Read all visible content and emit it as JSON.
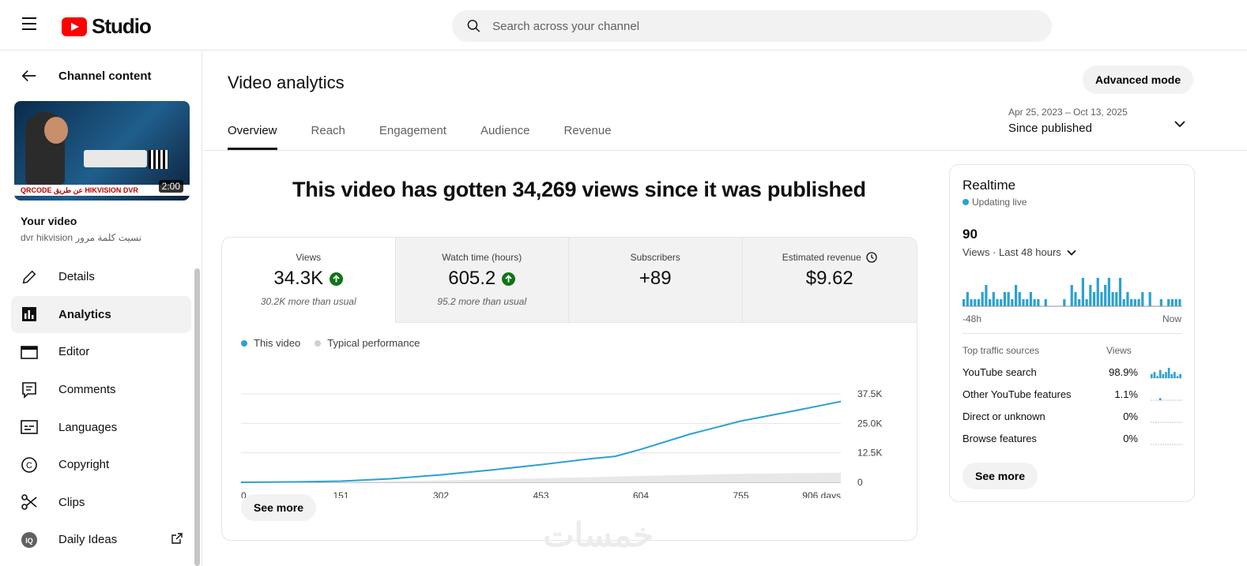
{
  "app": {
    "logo_text": "Studio",
    "search_placeholder": "Search across your channel"
  },
  "sidebar": {
    "back_label": "Channel content",
    "thumbnail": {
      "duration": "2:00",
      "banner_text": "QRCODE عن طريق HIKVISION DVR"
    },
    "your_video_label": "Your video",
    "video_title": "dvr hikvision نسيت كلمة مرور",
    "items": [
      {
        "label": "Details",
        "icon": "pencil-icon"
      },
      {
        "label": "Analytics",
        "icon": "analytics-icon",
        "active": true
      },
      {
        "label": "Editor",
        "icon": "clapperboard-icon"
      },
      {
        "label": "Comments",
        "icon": "comments-icon"
      },
      {
        "label": "Languages",
        "icon": "subtitles-icon"
      },
      {
        "label": "Copyright",
        "icon": "copyright-icon"
      },
      {
        "label": "Clips",
        "icon": "scissors-icon"
      },
      {
        "label": "Daily Ideas",
        "icon": "ideas-icon",
        "external": true
      }
    ]
  },
  "main": {
    "title": "Video analytics",
    "advanced_mode_label": "Advanced mode",
    "tabs": [
      {
        "label": "Overview",
        "active": true
      },
      {
        "label": "Reach"
      },
      {
        "label": "Engagement"
      },
      {
        "label": "Audience"
      },
      {
        "label": "Revenue"
      }
    ],
    "date_range": "Apr 25, 2023 – Oct 13, 2025",
    "date_label": "Since published",
    "headline": "This video has gotten 34,269 views since it was published",
    "metrics": [
      {
        "label": "Views",
        "value": "34.3K",
        "note": "30.2K more than usual",
        "trend": "up"
      },
      {
        "label": "Watch time (hours)",
        "value": "605.2",
        "note": "95.2 more than usual",
        "trend": "up"
      },
      {
        "label": "Subscribers",
        "value": "+89",
        "note": ""
      },
      {
        "label": "Estimated revenue",
        "value": "$9.62",
        "note": "",
        "info": true
      }
    ],
    "legend": {
      "this_video": "This video",
      "typical": "Typical performance"
    },
    "see_more_label": "See more"
  },
  "chart_data": {
    "type": "line",
    "title": "",
    "xlabel": "",
    "ylabel": "",
    "x_ticks": [
      "0",
      "151",
      "302",
      "453",
      "604",
      "755",
      "906 days"
    ],
    "y_ticks": [
      "0",
      "12.5K",
      "25.0K",
      "37.5K"
    ],
    "xlim": [
      0,
      906
    ],
    "ylim": [
      0,
      37500
    ],
    "series": [
      {
        "name": "This video",
        "color": "#2ba1d2",
        "x": [
          0,
          75,
          151,
          226,
          302,
          377,
          453,
          528,
          565,
          604,
          679,
          755,
          830,
          906
        ],
        "y": [
          0,
          150,
          500,
          1500,
          3200,
          5200,
          7500,
          10000,
          11000,
          14000,
          20500,
          26000,
          30000,
          34269
        ]
      },
      {
        "name": "Typical performance",
        "color": "#e8e8e8",
        "x": [
          0,
          151,
          302,
          453,
          604,
          755,
          906
        ],
        "y": [
          0,
          200,
          800,
          1700,
          2700,
          3600,
          4100
        ]
      }
    ]
  },
  "realtime": {
    "title": "Realtime",
    "live_label": "Updating live",
    "count": "90",
    "period_label": "Views · Last 48 hours",
    "axis_left": "-48h",
    "axis_right": "Now",
    "bars": [
      1,
      2,
      1,
      1,
      1,
      2,
      3,
      1,
      2,
      1,
      1,
      2,
      2,
      1,
      3,
      2,
      1,
      1,
      2,
      1,
      1,
      0,
      1,
      0,
      0,
      0,
      0,
      1,
      0,
      3,
      2,
      1,
      4,
      1,
      3,
      2,
      4,
      2,
      3,
      4,
      2,
      2,
      4,
      1,
      2,
      1,
      1,
      1,
      2,
      0,
      2,
      0,
      0,
      1,
      0,
      1,
      1,
      1,
      1
    ],
    "traffic_header": {
      "source": "Top traffic sources",
      "views": "Views"
    },
    "traffic": [
      {
        "source": "YouTube search",
        "pct": "98.9%",
        "spark": [
          2,
          3,
          1,
          4,
          2,
          3,
          5,
          2,
          3,
          1,
          2
        ]
      },
      {
        "source": "Other YouTube features",
        "pct": "1.1%",
        "spark": [
          0,
          0,
          0,
          1,
          0,
          0,
          0,
          0,
          0,
          0,
          0
        ]
      },
      {
        "source": "Direct or unknown",
        "pct": "0%",
        "spark": [
          0,
          0,
          0,
          0,
          0,
          0,
          0,
          0,
          0,
          0,
          0
        ]
      },
      {
        "source": "Browse features",
        "pct": "0%",
        "spark": [
          0,
          0,
          0,
          0,
          0,
          0,
          0,
          0,
          0,
          0,
          0
        ]
      }
    ],
    "see_more_label": "See more"
  },
  "watermark": "خمسات",
  "colors": {
    "accent": "#2ba1d2",
    "trend_up": "#107516",
    "brand_red": "#ff0000"
  }
}
